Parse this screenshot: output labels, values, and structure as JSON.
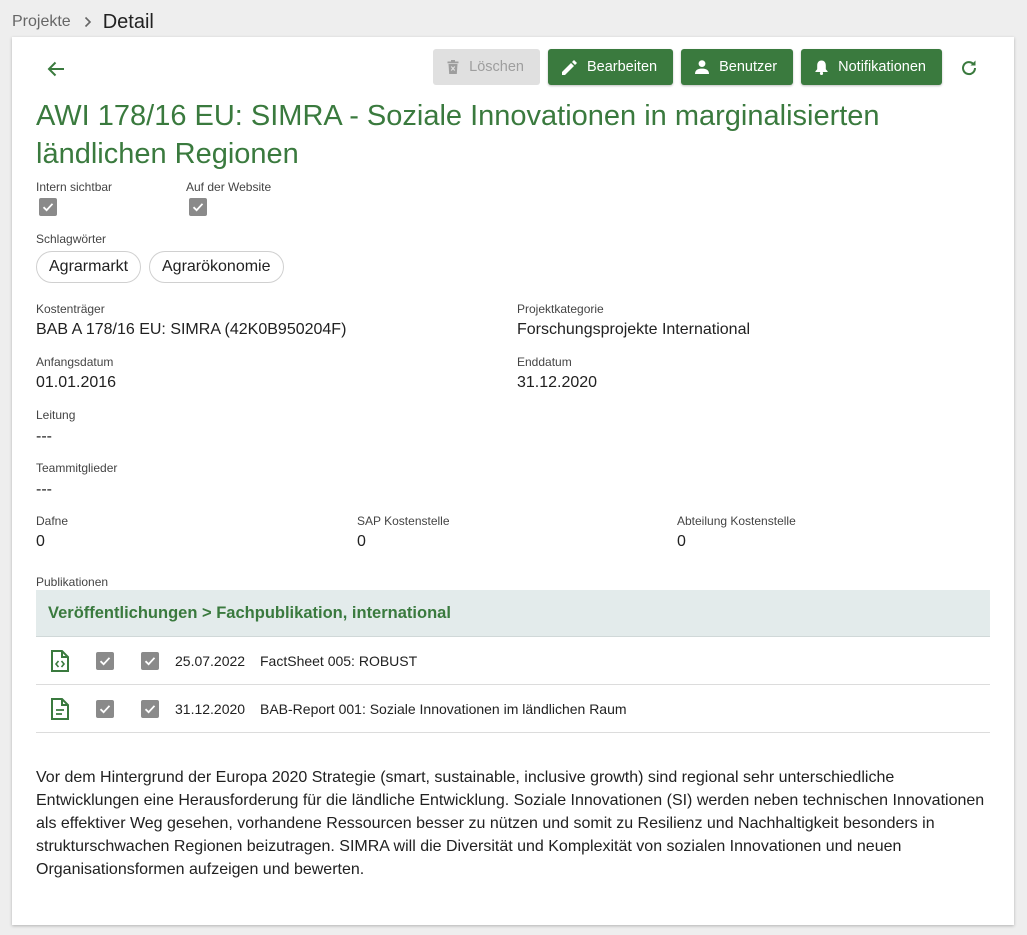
{
  "breadcrumb": {
    "parent": "Projekte",
    "current": "Detail"
  },
  "toolbar": {
    "delete_label": "Löschen",
    "edit_label": "Bearbeiten",
    "users_label": "Benutzer",
    "notifications_label": "Notifikationen"
  },
  "project": {
    "title": "AWI 178/16 EU: SIMRA - Soziale Innovationen in marginalisierten ländlichen Regionen",
    "intern_label": "Intern sichtbar",
    "intern_checked": true,
    "website_label": "Auf der Website",
    "website_checked": true,
    "keywords_label": "Schlagwörter",
    "keywords": [
      "Agrarmarkt",
      "Agrarökonomie"
    ],
    "cost_unit_label": "Kostenträger",
    "cost_unit": "BAB A 178/16 EU: SIMRA (42K0B950204F)",
    "category_label": "Projektkategorie",
    "category": "Forschungsprojekte International",
    "start_label": "Anfangsdatum",
    "start": "01.01.2016",
    "end_label": "Enddatum",
    "end": "31.12.2020",
    "lead_label": "Leitung",
    "lead": "---",
    "team_label": "Teammitglieder",
    "team": "---",
    "dafne_label": "Dafne",
    "dafne": "0",
    "sap_label": "SAP Kostenstelle",
    "sap": "0",
    "dept_label": "Abteilung Kostenstelle",
    "dept": "0"
  },
  "publications": {
    "label": "Publikationen",
    "group": "Veröffentlichungen > Fachpublikation, international",
    "items": [
      {
        "icon": "file-code-icon",
        "checked1": true,
        "checked2": true,
        "date": "25.07.2022",
        "title": "FactSheet 005: ROBUST"
      },
      {
        "icon": "file-document-icon",
        "checked1": true,
        "checked2": true,
        "date": "31.12.2020",
        "title": "BAB-Report 001: Soziale Innovationen im ländlichen Raum"
      }
    ]
  },
  "description": "Vor dem Hintergrund der Europa 2020 Strategie (smart, sustainable, inclusive growth) sind regional sehr unterschiedliche Entwicklungen eine Herausforderung für die ländliche Entwicklung. Soziale Innovationen (SI) werden neben technischen Innovationen als effektiver Weg gesehen, vorhandene Ressourcen besser zu nützen und somit zu Resilienz und Nachhaltigkeit besonders in strukturschwachen Regionen beizutragen. SIMRA will die Diversität und Komplexität von sozialen Innovationen und neuen Organisationsformen aufzeigen und bewerten.",
  "colors": {
    "primary": "#3a7a3e",
    "disabled_bg": "#e0e0e0",
    "header_bg": "#e3ebeb",
    "checkbox": "#8a8a8a"
  }
}
